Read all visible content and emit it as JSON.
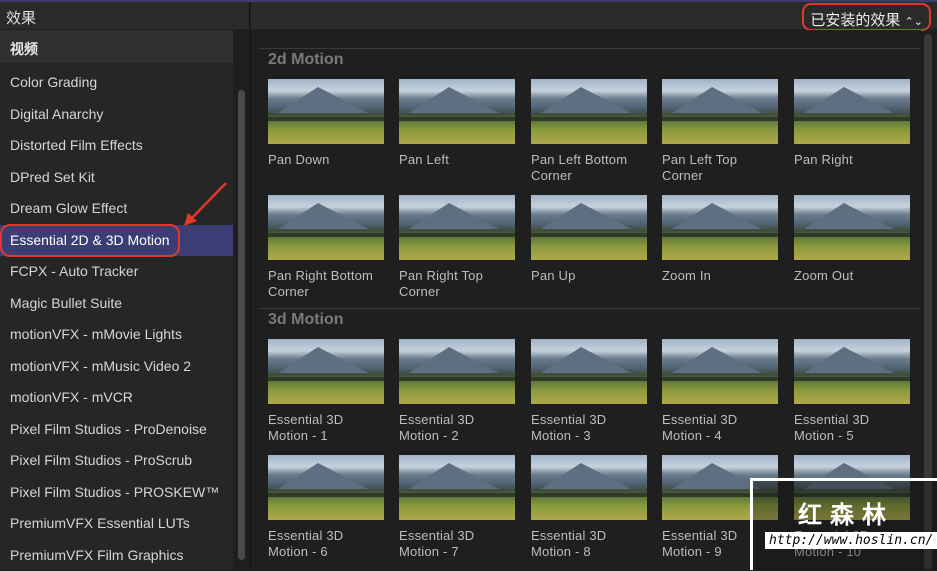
{
  "header": {
    "title": "效果",
    "filter": "已安装的效果",
    "filter_icon": "up-down-chevron-icon"
  },
  "sidebar": {
    "category": "视频",
    "selected": "Essential 2D & 3D Motion",
    "items": [
      "Color Grading",
      "Digital Anarchy",
      "Distorted Film Effects",
      "DPred Set Kit",
      "Dream Glow Effect",
      "Essential 2D & 3D Motion",
      "FCPX - Auto Tracker",
      "Magic Bullet Suite",
      "motionVFX - mMovie Lights",
      "motionVFX - mMusic Video 2",
      "motionVFX - mVCR",
      "Pixel Film Studios - ProDenoise",
      "Pixel Film Studios - ProScrub",
      "Pixel Film Studios - PROSKEW™",
      "PremiumVFX Essential LUTs",
      "PremiumVFX Film Graphics"
    ]
  },
  "sections": [
    {
      "title": "2d Motion",
      "items": [
        [
          "Pan Down"
        ],
        [
          "Pan Left"
        ],
        [
          "Pan Left Bottom",
          "Corner"
        ],
        [
          "Pan Left Top",
          "Corner"
        ],
        [
          "Pan Right"
        ],
        [
          "Pan Right Bottom",
          "Corner"
        ],
        [
          "Pan Right Top",
          "Corner"
        ],
        [
          "Pan Up"
        ],
        [
          "Zoom In"
        ],
        [
          "Zoom Out"
        ]
      ]
    },
    {
      "title": "3d Motion",
      "items": [
        [
          "Essential 3D",
          "Motion - 1"
        ],
        [
          "Essential 3D",
          "Motion - 2"
        ],
        [
          "Essential 3D",
          "Motion - 3"
        ],
        [
          "Essential 3D",
          "Motion - 4"
        ],
        [
          "Essential 3D",
          "Motion - 5"
        ],
        [
          "Essential 3D",
          "Motion - 6"
        ],
        [
          "Essential 3D",
          "Motion - 7"
        ],
        [
          "Essential 3D",
          "Motion - 8"
        ],
        [
          "Essential 3D",
          "Motion - 9"
        ],
        [
          "Essential 3D",
          "Motion - 10"
        ]
      ]
    }
  ],
  "watermark": {
    "name": "红森林",
    "url": "http://www.hoslin.cn/"
  },
  "colors": {
    "selection": "#3b3d74",
    "annotation": "#e0392b"
  }
}
